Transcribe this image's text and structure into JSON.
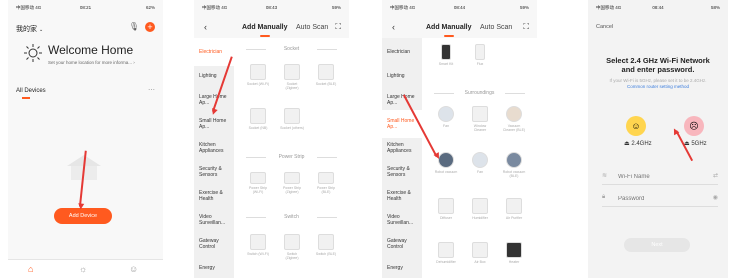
{
  "screen1": {
    "status": {
      "left": "中国移动 4G",
      "time": "08:21",
      "right": "62%"
    },
    "home_name": "我的家",
    "welcome_title": "Welcome Home",
    "welcome_sub": "Set your home location for more informa...",
    "all_devices": "All Devices",
    "add_device": "Add Device",
    "more_icon": "⋯"
  },
  "screen2": {
    "status": {
      "left": "中国移动 4G",
      "time": "08:43",
      "right": "59%"
    },
    "tab_manual": "Add Manually",
    "tab_scan": "Auto Scan",
    "categories": [
      "Electrician",
      "Lighting",
      "Large Home Ap...",
      "Small Home Ap...",
      "Kitchen Appliances",
      "Security & Sensors",
      "Exercise & Health",
      "Video Surveillan...",
      "Gateway Control",
      "Energy"
    ],
    "sections": [
      "Socket",
      "Power Strip",
      "Switch"
    ],
    "socket_devices": [
      "Socket (Wi-Fi)",
      "Socket (Zigbee)",
      "Socket (BLE)",
      "Socket (NB)",
      "Socket (others)"
    ],
    "strip_devices": [
      "Power Strip (Wi-Fi)",
      "Power Strip (Zigbee)",
      "Power Strip (BLE)"
    ],
    "switch_devices": [
      "Switch (Wi-Fi)",
      "Switch (Zigbee)",
      "Switch (BLE)"
    ]
  },
  "screen3": {
    "status": {
      "left": "中国移动 4G",
      "time": "08:44",
      "right": "59%"
    },
    "tab_manual": "Add Manually",
    "tab_scan": "Auto Scan",
    "categories": [
      "Electrician",
      "Lighting",
      "Large Home Ap...",
      "Small Home Ap...",
      "Kitchen Appliances",
      "Security & Sensors",
      "Exercise & Health",
      "Video Surveillan...",
      "Gateway Control",
      "Energy"
    ],
    "section": "Surroundings",
    "top_devices": [
      "Smart Kit",
      "Flux"
    ],
    "devices": [
      "Fan",
      "Window Cleaner",
      "Vacuum Cleaner (BLE)",
      "Robot vacuum",
      "Fan",
      "Robot vacuum (BLE)",
      "Diffuser",
      "Humidifier",
      "Air Purifier",
      "Dehumidifier",
      "Air Box",
      "Heater"
    ]
  },
  "screen4": {
    "status": {
      "left": "中国移动 4G",
      "time": "08:44",
      "right": "58%"
    },
    "cancel": "Cancel",
    "title": "Select 2.4 GHz Wi-Fi Network and enter password.",
    "hint": "If your Wi-Fi is 5GHz, please set it to be 2.4GHz.",
    "hint_link": "Common router setting method",
    "band_ok": "2.4GHz",
    "band_bad": "5GHz",
    "wifi_placeholder": "Wi-Fi Name",
    "password_placeholder": "Password",
    "next": "Next"
  },
  "colors": {
    "accent": "#ff5a1f",
    "arrow": "#e53935"
  }
}
